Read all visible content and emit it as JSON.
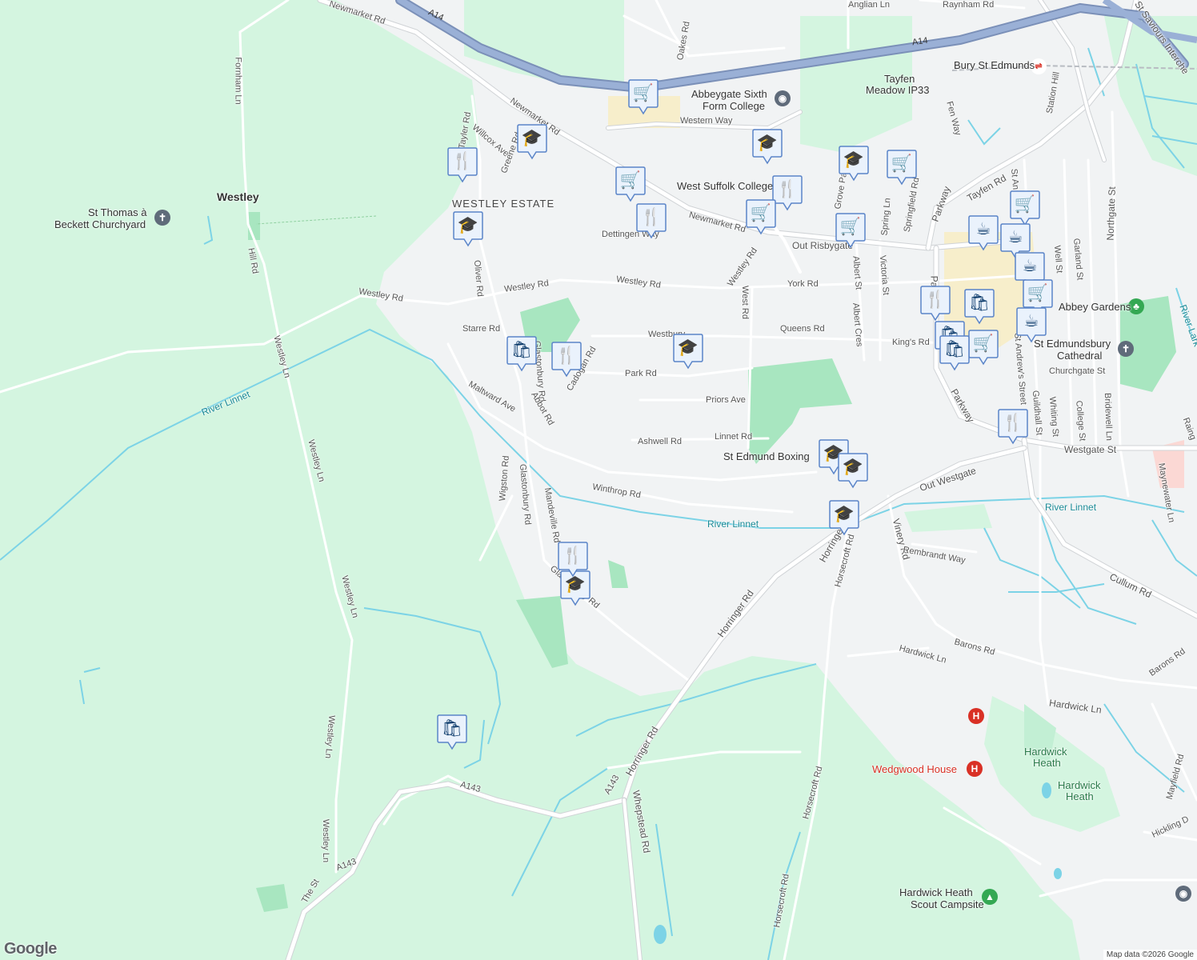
{
  "map": {
    "colors": {
      "land": "#f1f3f4",
      "green": "#d4f5e0",
      "park": "#a8e6c0",
      "water": "#7cd3e6",
      "road": "#ffffff",
      "road_casing": "#d0d3d6",
      "motorway": "#8fa4c8",
      "marker_fill": "#eaf2fc",
      "marker_stroke": "#5a84c8",
      "marker_glyph": "#0b3a6a",
      "hospital": "#d93025"
    },
    "labels": {
      "places": {
        "westley": "Westley",
        "westley_estate": "WESTLEY ESTATE",
        "st_thomas_1": "St Thomas à",
        "st_thomas_2": "Beckett Churchyard",
        "bury": "Bury St Edmunds",
        "tayfen_1": "Tayfen",
        "tayfen_2": "Meadow IP33",
        "abbeygate_1": "Abbeygate Sixth",
        "abbeygate_2": "Form College",
        "west_suffolk": "West Suffolk College",
        "abbey_gardens": "Abbey Gardens",
        "cathedral_1": "St Edmundsbury",
        "cathedral_2": "Cathedral",
        "boxing": "St Edmund Boxing",
        "wedgwood": "Wedgwood House",
        "hardwick_heath_1a": "Hardwick",
        "hardwick_heath_1b": "Heath",
        "hardwick_heath_2a": "Hardwick",
        "hardwick_heath_2b": "Heath",
        "scout_1": "Hardwick Heath",
        "scout_2": "Scout Campsite"
      },
      "water": {
        "linnet_1": "River Linnet",
        "linnet_2": "River Linnet",
        "linnet_3": "River Linnet",
        "lark": "River Lark"
      },
      "roads": {
        "newmarket_rd_1": "Newmarket Rd",
        "newmarket_rd_2": "Newmarket Rd",
        "newmarket_rd_3": "Newmarket Rd",
        "a14_1": "A14",
        "a14_2": "A14",
        "fornham_ln": "Fornham Ln",
        "hill_rd": "Hill Rd",
        "westley_ln_1": "Westley Ln",
        "westley_ln_2": "Westley Ln",
        "westley_ln_3": "Westley Ln",
        "westley_ln_4": "Westley Ln",
        "westley_ln_5": "Westley Ln",
        "westley_rd_1": "Westley Rd",
        "westley_rd_2": "Westley Rd",
        "westley_rd_3": "Westley Rd",
        "westley_rd_4": "Westley Rd",
        "starre_rd": "Starre Rd",
        "oliver_rd": "Oliver Rd",
        "willcox_ave": "Willcox Ave",
        "greene_rd": "Greene Rd",
        "tayler_rd": "Tayler Rd",
        "dettingen_way": "Dettingen Way",
        "western_way": "Western Way",
        "out_risbygate": "Out Risbygate",
        "york_rd": "York Rd",
        "queens_rd": "Queens Rd",
        "kings_rd": "King's Rd",
        "west_rd": "West Rd",
        "westbury": "Westbury",
        "glastonbury_rd_1": "Glastonbury Rd",
        "glastonbury_rd_2": "Glastonbury Rd",
        "glastonbury_rd_3": "Glastonbury Rd",
        "abbot_rd": "Abbot Rd",
        "maltward_ave": "Maltward Ave",
        "wigston_rd": "Wigston Rd",
        "mandeville_rd": "Mandeville Rd",
        "cadogan_rd": "Cadogan Rd",
        "park_rd": "Park Rd",
        "priors_ave": "Priors Ave",
        "ashwell_rd": "Ashwell Rd",
        "linnet_rd": "Linnet Rd",
        "winthrop_rd": "Winthrop Rd",
        "out_westgate": "Out Westgate",
        "westgate_st": "Westgate St",
        "horringer_rd_1": "Horringer Rd",
        "horringer_rd_2": "Horringer Rd",
        "horringer_rd_3": "Horringer Rd",
        "horsecroft_rd_1": "Horsecroft Rd",
        "horsecroft_rd_2": "Horsecroft Rd",
        "horsecroft_rd_3": "Horsecroft Rd",
        "vinery_rd": "Vinery Rd",
        "rembrandt_way": "Rembrandt Way",
        "barons_rd_1": "Barons Rd",
        "barons_rd_2": "Barons Rd",
        "hardwick_ln_1": "Hardwick Ln",
        "hardwick_ln_2": "Hardwick Ln",
        "cullum_rd": "Cullum Rd",
        "parkway_1": "Parkway",
        "parkway_2": "Parkway",
        "parkway_3": "Pa",
        "tayfen_rd": "Tayfen Rd",
        "northgate_st": "Northgate St",
        "station_hill": "Station Hill",
        "fen_way": "Fen Way",
        "grove_park": "Grove Park",
        "springfield_rd": "Springfield Rd",
        "spring_ln": "Spring Ln",
        "victoria_st": "Victoria St",
        "albert_st": "Albert St",
        "albert_cres": "Albert Cres",
        "garland_st": "Garland St",
        "well_st": "Well St",
        "st_andrews_1": "St Andrew's Street",
        "st_andrews_2": "St An",
        "guildhall_st": "Guildhall St",
        "whiting_st": "Whiting St",
        "college_st": "College St",
        "bridewell_ln": "Bridewell Ln",
        "churchgate_st": "Churchgate St",
        "maynewater_ln": "Maynewater Ln",
        "raingate": "Raing",
        "mayfield_rd": "Mayfield Rd",
        "hickling": "Hickling D",
        "oakes_rd": "Oakes Rd",
        "anglian_ln": "Anglian Ln",
        "raynham_rd": "Raynham Rd",
        "a143_1": "A143",
        "a143_2": "A143",
        "a143_3": "A143",
        "whepstead_rd": "Whepstead Rd",
        "the_st": "The St",
        "st_saviours": "St Saviours Interche"
      }
    },
    "markers": [
      {
        "type": "shopping-cart",
        "glyph": "🛒"
      },
      {
        "type": "school",
        "glyph": "🎓"
      },
      {
        "type": "restaurant",
        "glyph": "🍴"
      },
      {
        "type": "shopping-cart",
        "glyph": "🛒"
      },
      {
        "type": "school",
        "glyph": "🎓"
      },
      {
        "type": "restaurant",
        "glyph": "🍴"
      },
      {
        "type": "school",
        "glyph": "🎓"
      },
      {
        "type": "restaurant",
        "glyph": "🍴"
      },
      {
        "type": "shopping-cart",
        "glyph": "🛒"
      },
      {
        "type": "school",
        "glyph": "🎓"
      },
      {
        "type": "shopping-cart",
        "glyph": "🛒"
      },
      {
        "type": "shopping-cart",
        "glyph": "🛒"
      },
      {
        "type": "shopping-bag",
        "glyph": "🛍"
      },
      {
        "type": "restaurant",
        "glyph": "🍴"
      },
      {
        "type": "school",
        "glyph": "🎓"
      },
      {
        "type": "school",
        "glyph": "🎓"
      },
      {
        "type": "school",
        "glyph": "🎓"
      },
      {
        "type": "restaurant",
        "glyph": "🍴"
      },
      {
        "type": "school",
        "glyph": "🎓"
      },
      {
        "type": "school",
        "glyph": "🎓"
      },
      {
        "type": "shopping-bag",
        "glyph": "🛍"
      },
      {
        "type": "shopping-cart",
        "glyph": "🛒"
      },
      {
        "type": "cafe",
        "glyph": "☕"
      },
      {
        "type": "cafe",
        "glyph": "☕"
      },
      {
        "type": "cafe",
        "glyph": "☕"
      },
      {
        "type": "restaurant",
        "glyph": "🍴"
      },
      {
        "type": "shopping-bag",
        "glyph": "🛍"
      },
      {
        "type": "shopping-bag",
        "glyph": "🛍"
      },
      {
        "type": "shopping-cart",
        "glyph": "🛒"
      },
      {
        "type": "shopping-cart",
        "glyph": "🛒"
      },
      {
        "type": "cafe",
        "glyph": "☕"
      },
      {
        "type": "restaurant",
        "glyph": "🍴"
      },
      {
        "type": "shopping-bag",
        "glyph": "🛍"
      }
    ],
    "logo": "Google",
    "attribution": "Map data ©2026 Google"
  }
}
